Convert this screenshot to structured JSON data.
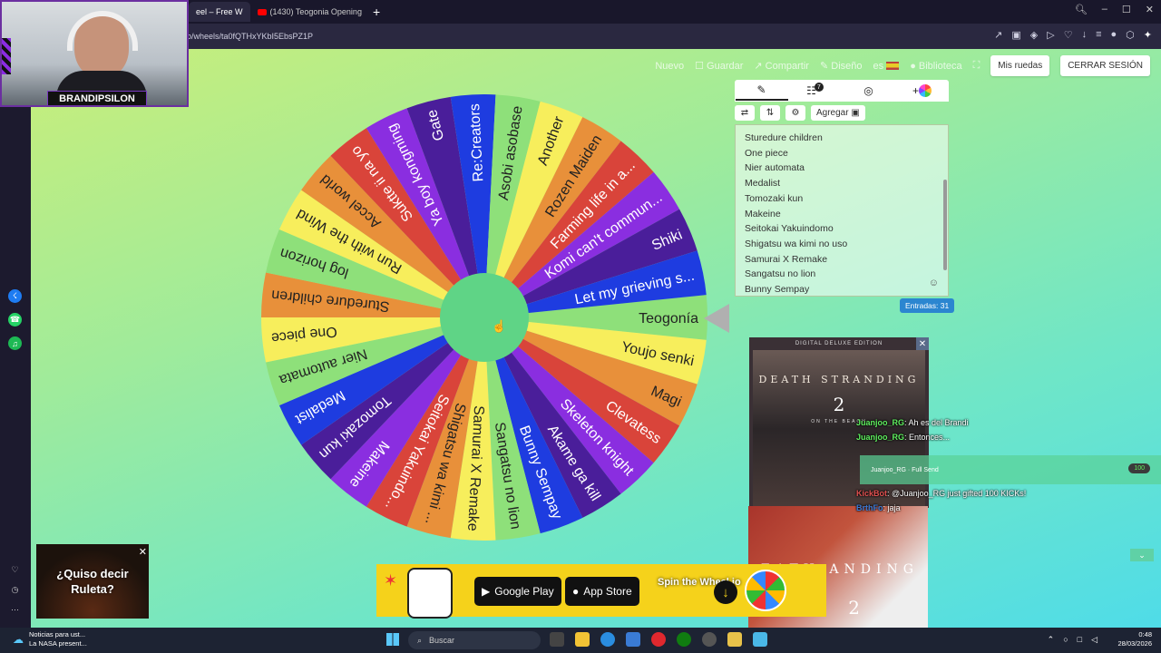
{
  "browser": {
    "tabs": [
      {
        "label": "eel – Free W"
      },
      {
        "label": "(1430) Teogonia Opening"
      }
    ],
    "new_tab": "+",
    "url": "o/wheels/ta0fQTHxYKbI5EbsPZ1P"
  },
  "webcam": {
    "name": "BRANDIPSILON"
  },
  "nav": {
    "nuevo": "Nuevo",
    "guardar": "Guardar",
    "compartir": "Compartir",
    "diseno": "Diseño",
    "lang": "es",
    "biblioteca": "Biblioteca",
    "mis_ruedas": "Mis ruedas",
    "cerrar": "CERRAR SESIÓN"
  },
  "wheel": {
    "segments": [
      {
        "label": "Teogonía",
        "color": "#8ee07a"
      },
      {
        "label": "Youjo senki",
        "color": "#f7ee5c"
      },
      {
        "label": "Magi",
        "color": "#e8903a"
      },
      {
        "label": "Clevatess",
        "color": "#d9443a"
      },
      {
        "label": "Skeleton knight",
        "color": "#8a2ee0"
      },
      {
        "label": "Akame ga kill",
        "color": "#4a1e9a"
      },
      {
        "label": "Bunny Sempay",
        "color": "#1e3ce0"
      },
      {
        "label": "Sangatsu no lion",
        "color": "#8ee07a"
      },
      {
        "label": "Samurai X Remake",
        "color": "#f7ee5c"
      },
      {
        "label": "Shigatsu wa kimi ...",
        "color": "#e8903a"
      },
      {
        "label": "Seitokai Yakuindo...",
        "color": "#d9443a"
      },
      {
        "label": "Makeine",
        "color": "#8a2ee0"
      },
      {
        "label": "Tomozaki kun",
        "color": "#4a1e9a"
      },
      {
        "label": "Medalist",
        "color": "#1e3ce0"
      },
      {
        "label": "Nier automata",
        "color": "#8ee07a"
      },
      {
        "label": "One piece",
        "color": "#f7ee5c"
      },
      {
        "label": "Sturedure children",
        "color": "#e8903a"
      },
      {
        "label": "log horizon",
        "color": "#8ee07a"
      },
      {
        "label": "Run with the Wind",
        "color": "#f7ee5c"
      },
      {
        "label": "Accel world",
        "color": "#e8903a"
      },
      {
        "label": "Suktte ii na yo",
        "color": "#d9443a"
      },
      {
        "label": "Ya boy kongming",
        "color": "#8a2ee0"
      },
      {
        "label": "Gate",
        "color": "#4a1e9a"
      },
      {
        "label": "Re:Creators",
        "color": "#1e3ce0"
      },
      {
        "label": "Asobi asobase",
        "color": "#8ee07a"
      },
      {
        "label": "Another",
        "color": "#f7ee5c"
      },
      {
        "label": "Rozen Maiden",
        "color": "#e8903a"
      },
      {
        "label": "Farming life in a...",
        "color": "#d9443a"
      },
      {
        "label": "Komi can't commun...",
        "color": "#8a2ee0"
      },
      {
        "label": "Shiki",
        "color": "#4a1e9a"
      },
      {
        "label": "Let my grieving s...",
        "color": "#1e3ce0"
      }
    ]
  },
  "editor": {
    "badge": "7",
    "add_label": "Agregar",
    "entries": [
      "Sturedure children",
      "One piece",
      "Nier automata",
      "Medalist",
      "Tomozaki kun",
      "Makeine",
      "Seitokai Yakuindomo",
      "Shigatsu wa kimi no uso",
      "Samurai X Remake",
      "Sangatsu no lion",
      "Bunny Sempay"
    ],
    "count": "Entradas: 31"
  },
  "ad": {
    "edition": "DIGITAL DELUXE EDITION",
    "title": "DEATH STRANDING",
    "number": "2",
    "subtitle": "ON THE BEACH",
    "title2": "EATH ANDING",
    "number2": "2"
  },
  "chat": {
    "l1_user": "Juanjoo_RG",
    "l1_msg": ": Ah es del Brandi",
    "l2_user": "Juanjoo_RG",
    "l2_msg": ": Entonces...",
    "gift_user": "Juanjoo_RG",
    "gift_note": "Full Send",
    "gift_amount": "100",
    "l3_user": "KickBot",
    "l3_msg": ": @Juanjoo_RG just gifted 100 KICKs!",
    "l4_user": "BrthFo",
    "l4_msg": ": jaja"
  },
  "banner": {
    "google": "Google Play",
    "apple": "App Store",
    "spin": "Spin the Wheel.io"
  },
  "roulette": {
    "text": "¿Quiso decir Ruleta?"
  },
  "taskbar": {
    "news1": "Noticias para ust...",
    "news2": "La NASA present...",
    "search": "Buscar",
    "time": "0:48",
    "date": "28/03/2026"
  }
}
